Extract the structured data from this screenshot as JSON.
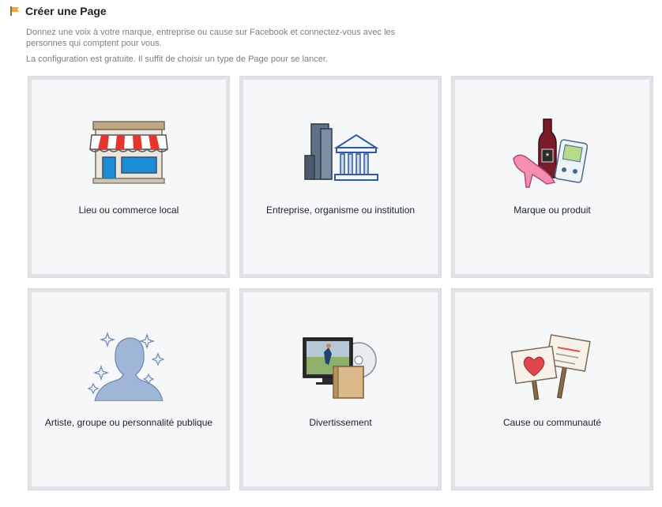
{
  "header": {
    "title": "Créer une Page",
    "description": "Donnez une voix à votre marque, entreprise ou cause sur Facebook et connectez-vous avec les personnes qui comptent pour vous.",
    "note": "La configuration est gratuite. Il suffit de choisir un type de Page pour se lancer."
  },
  "categories": [
    {
      "label": "Lieu ou commerce local",
      "icon": "storefront-icon"
    },
    {
      "label": "Entreprise, organisme ou institution",
      "icon": "buildings-icon"
    },
    {
      "label": "Marque ou produit",
      "icon": "products-icon"
    },
    {
      "label": "Artiste, groupe ou personnalité publique",
      "icon": "public-figure-icon"
    },
    {
      "label": "Divertissement",
      "icon": "entertainment-icon"
    },
    {
      "label": "Cause ou communauté",
      "icon": "cause-signs-icon"
    }
  ],
  "colors": {
    "card_bg": "#f6f7f9",
    "card_border": "#e2e3e6",
    "title_text": "#1d2129",
    "muted_text": "#7f7f7f",
    "flag_orange": "#f7a23b"
  }
}
